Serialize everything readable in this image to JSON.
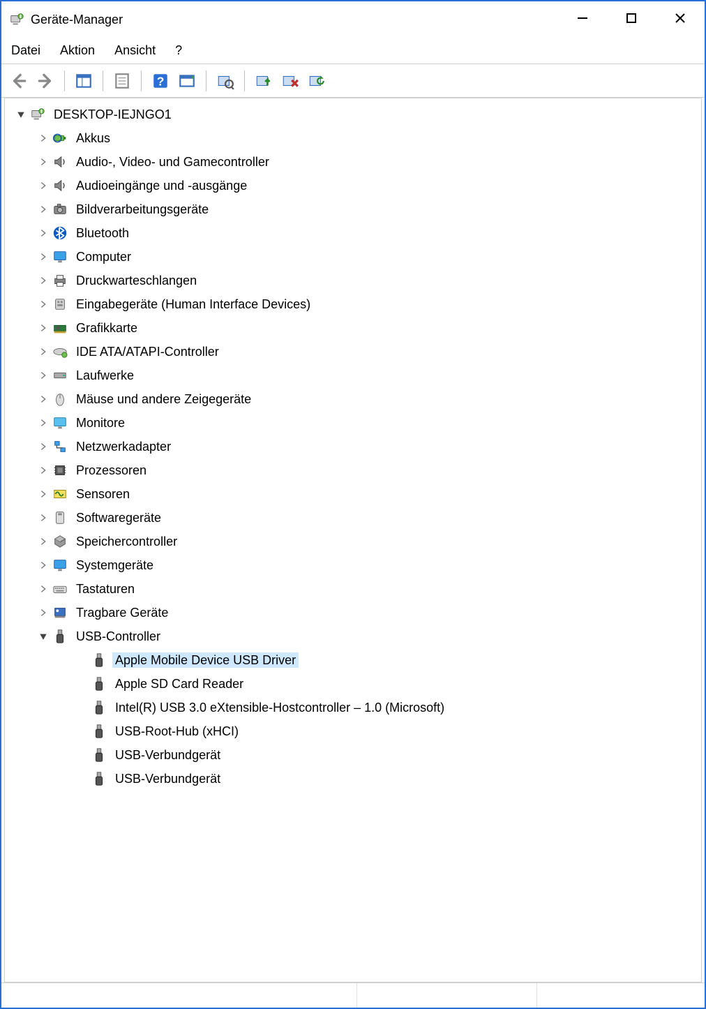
{
  "window": {
    "title": "Geräte-Manager"
  },
  "menu": {
    "file": "Datei",
    "action": "Aktion",
    "view": "Ansicht",
    "help": "?"
  },
  "tree": {
    "root": {
      "label": "DESKTOP-IEJNGO1",
      "expanded": true
    },
    "categories": [
      {
        "label": "Akkus",
        "icon": "battery"
      },
      {
        "label": "Audio-, Video- und Gamecontroller",
        "icon": "speaker"
      },
      {
        "label": "Audioeingänge und -ausgänge",
        "icon": "speaker"
      },
      {
        "label": "Bildverarbeitungsgeräte",
        "icon": "camera"
      },
      {
        "label": "Bluetooth",
        "icon": "bluetooth"
      },
      {
        "label": "Computer",
        "icon": "monitor"
      },
      {
        "label": "Druckwarteschlangen",
        "icon": "printer"
      },
      {
        "label": "Eingabegeräte (Human Interface Devices)",
        "icon": "hid"
      },
      {
        "label": "Grafikkarte",
        "icon": "gpu"
      },
      {
        "label": "IDE ATA/ATAPI-Controller",
        "icon": "ide"
      },
      {
        "label": "Laufwerke",
        "icon": "disk"
      },
      {
        "label": "Mäuse und andere Zeigegeräte",
        "icon": "mouse"
      },
      {
        "label": "Monitore",
        "icon": "monitor2"
      },
      {
        "label": "Netzwerkadapter",
        "icon": "network"
      },
      {
        "label": "Prozessoren",
        "icon": "cpu"
      },
      {
        "label": "Sensoren",
        "icon": "sensor"
      },
      {
        "label": "Softwaregeräte",
        "icon": "software"
      },
      {
        "label": "Speichercontroller",
        "icon": "storage"
      },
      {
        "label": "Systemgeräte",
        "icon": "monitor"
      },
      {
        "label": "Tastaturen",
        "icon": "keyboard"
      },
      {
        "label": "Tragbare Geräte",
        "icon": "portable"
      },
      {
        "label": "USB-Controller",
        "icon": "usb",
        "expanded": true
      }
    ],
    "usb_children": [
      {
        "label": "Apple Mobile Device USB Driver",
        "selected": true
      },
      {
        "label": "Apple SD Card Reader"
      },
      {
        "label": "Intel(R) USB 3.0 eXtensible-Hostcontroller – 1.0 (Microsoft)"
      },
      {
        "label": "USB-Root-Hub (xHCI)"
      },
      {
        "label": "USB-Verbundgerät"
      },
      {
        "label": "USB-Verbundgerät"
      }
    ]
  }
}
